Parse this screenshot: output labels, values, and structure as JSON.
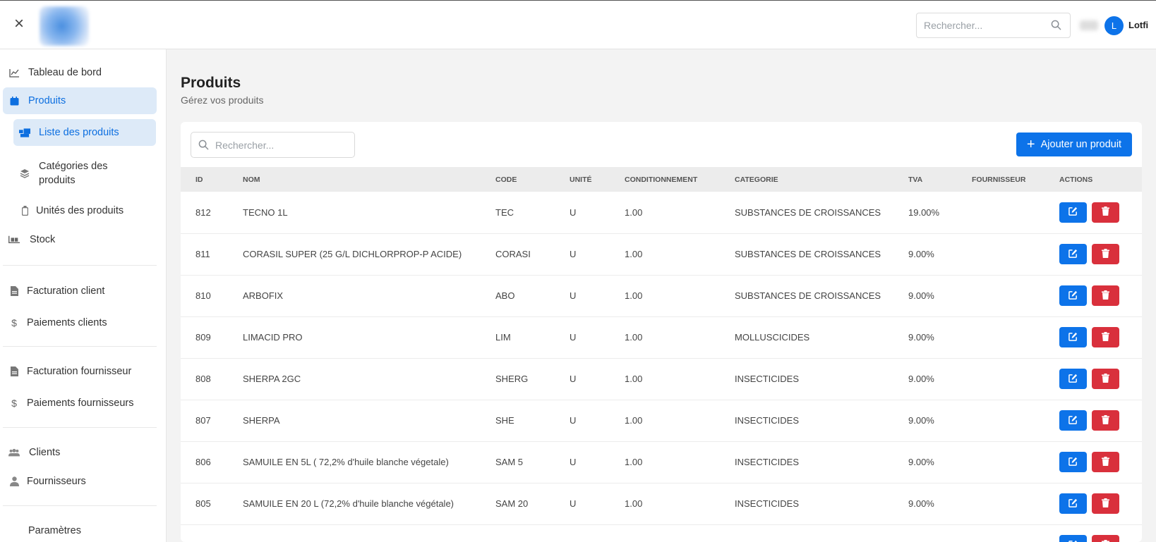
{
  "header": {
    "search_placeholder": "Rechercher...",
    "user_initial": "L",
    "user_name": "Lotfi"
  },
  "sidebar": {
    "items": [
      {
        "label": "Tableau de bord",
        "icon": "chart-line-icon"
      },
      {
        "label": "Produits",
        "icon": "calendar-icon"
      },
      {
        "label": "Liste des produits",
        "icon": "boxes-icon"
      },
      {
        "label": "Catégories des produits",
        "icon": "layers-icon"
      },
      {
        "label": "Unités des produits",
        "icon": "bottle-icon"
      },
      {
        "label": "Stock",
        "icon": "pallet-icon"
      },
      {
        "label": "Facturation client",
        "icon": "file-icon"
      },
      {
        "label": "Paiements clients",
        "icon": "dollar-icon"
      },
      {
        "label": "Facturation fournisseur",
        "icon": "file-icon"
      },
      {
        "label": "Paiements fournisseurs",
        "icon": "dollar-icon"
      },
      {
        "label": "Clients",
        "icon": "users-icon"
      },
      {
        "label": "Fournisseurs",
        "icon": "user-tie-icon"
      },
      {
        "label": "Paramètres",
        "icon": ""
      }
    ]
  },
  "page": {
    "title": "Produits",
    "subtitle": "Gérez vos produits",
    "search_placeholder": "Rechercher...",
    "add_button_label": "Ajouter un produit"
  },
  "table": {
    "headers": [
      "ID",
      "NOM",
      "CODE",
      "UNITÉ",
      "CONDITIONNEMENT",
      "CATEGORIE",
      "TVA",
      "FOURNISSEUR",
      "ACTIONS"
    ],
    "rows": [
      {
        "id": "812",
        "nom": "TECNO 1L",
        "code": "TEC",
        "unite": "U",
        "cond": "1.00",
        "cat": "SUBSTANCES DE CROISSANCES",
        "tva": "19.00%",
        "four": ""
      },
      {
        "id": "811",
        "nom": "CORASIL SUPER (25 G/L DICHLORPROP-P ACIDE)",
        "code": "CORASI",
        "unite": "U",
        "cond": "1.00",
        "cat": "SUBSTANCES DE CROISSANCES",
        "tva": "9.00%",
        "four": ""
      },
      {
        "id": "810",
        "nom": "ARBOFIX",
        "code": "ABO",
        "unite": "U",
        "cond": "1.00",
        "cat": "SUBSTANCES DE CROISSANCES",
        "tva": "9.00%",
        "four": ""
      },
      {
        "id": "809",
        "nom": "LIMACID PRO",
        "code": "LIM",
        "unite": "U",
        "cond": "1.00",
        "cat": "MOLLUSCICIDES",
        "tva": "9.00%",
        "four": ""
      },
      {
        "id": "808",
        "nom": "SHERPA 2GC",
        "code": "SHERG",
        "unite": "U",
        "cond": "1.00",
        "cat": "INSECTICIDES",
        "tva": "9.00%",
        "four": ""
      },
      {
        "id": "807",
        "nom": "SHERPA",
        "code": "SHE",
        "unite": "U",
        "cond": "1.00",
        "cat": "INSECTICIDES",
        "tva": "9.00%",
        "four": ""
      },
      {
        "id": "806",
        "nom": "SAMUILE EN 5L ( 72,2% d'huile blanche végetale)",
        "code": "SAM 5",
        "unite": "U",
        "cond": "1.00",
        "cat": "INSECTICIDES",
        "tva": "9.00%",
        "four": ""
      },
      {
        "id": "805",
        "nom": "SAMUILE EN 20 L (72,2% d'huile blanche végétale)",
        "code": "SAM 20",
        "unite": "U",
        "cond": "1.00",
        "cat": "INSECTICIDES",
        "tva": "9.00%",
        "four": ""
      },
      {
        "id": "",
        "nom": "",
        "code": "",
        "unite": "",
        "cond": "",
        "cat": "",
        "tva": "",
        "four": ""
      }
    ]
  },
  "colors": {
    "accent": "#0d73e9",
    "danger": "#d9303c",
    "active_bg": "#ddeaf8"
  }
}
